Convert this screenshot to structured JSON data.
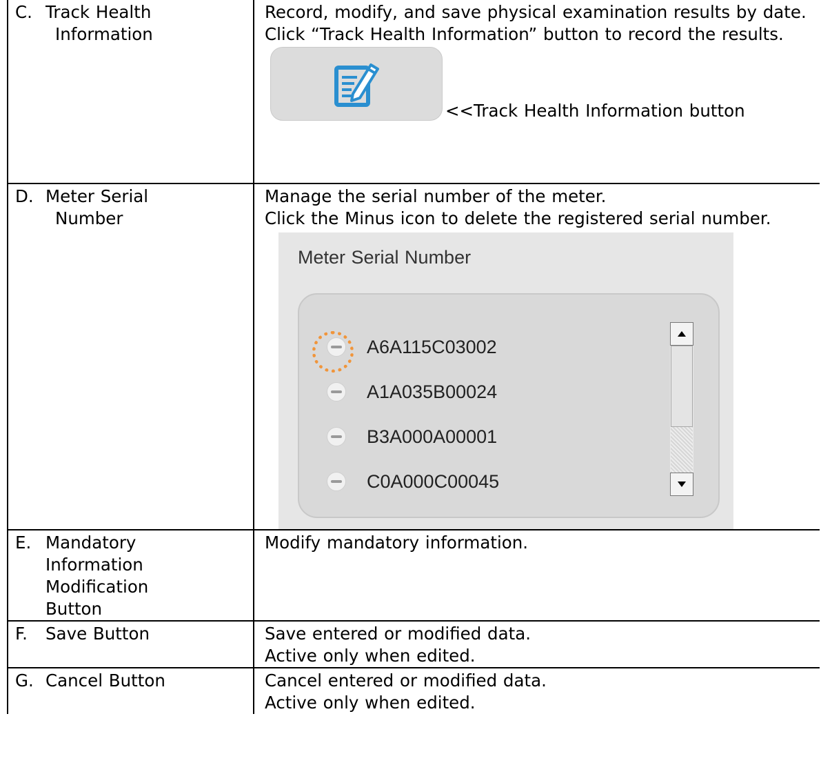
{
  "rows": [
    {
      "letter": "C.",
      "label_lines": [
        "Track Health",
        "Information"
      ],
      "desc_lines": [
        "Record, modify, and save physical examination results by date.",
        "Click “Track Health Information” button to record the results."
      ],
      "image_caption": "<<Track Health Information button",
      "image_icon": "edit-note-icon"
    },
    {
      "letter": "D.",
      "label_lines": [
        "Meter Serial",
        "Number"
      ],
      "desc_lines": [
        "Manage the serial number of the meter.",
        "Click the Minus icon to delete the registered serial number."
      ],
      "panel": {
        "title": "Meter Serial Number",
        "serials": [
          "A6A115C03002",
          "A1A035B00024",
          "B3A000A00001",
          "C0A000C00045"
        ],
        "highlight_color": "#f0953b"
      }
    },
    {
      "letter": "E.",
      "label_lines": [
        "Mandatory",
        "Information",
        "Modification",
        "Button"
      ],
      "desc_lines": [
        "Modify mandatory information."
      ]
    },
    {
      "letter": "F.",
      "label_lines": [
        "Save Button"
      ],
      "desc_lines": [
        "Save entered or modified data.",
        "Active only when edited."
      ]
    },
    {
      "letter": "G.",
      "label_lines": [
        "Cancel Button"
      ],
      "desc_lines": [
        "Cancel entered or modified data.",
        "Active only when edited."
      ]
    }
  ]
}
